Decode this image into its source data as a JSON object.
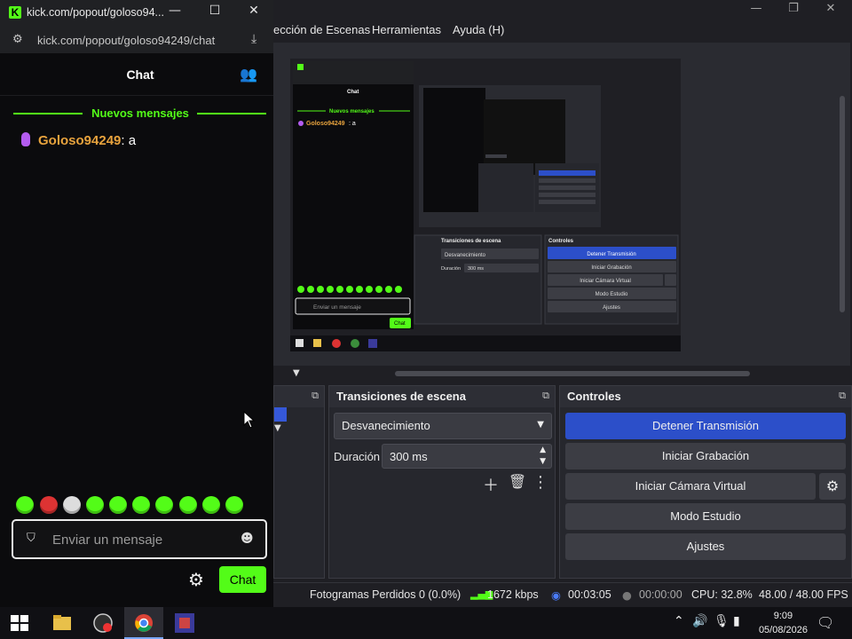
{
  "obs": {
    "menu": [
      "ección de Escenas",
      "Herramientas",
      "Ayuda (H)"
    ],
    "transitions": {
      "title": "Transiciones de escena",
      "transition_value": "Desvanecimiento",
      "duration_label": "Duración",
      "duration_value": "300 ms"
    },
    "controls": {
      "title": "Controles",
      "buttons": [
        "Detener Transmisión",
        "Iniciar Grabación",
        "Iniciar Cámara Virtual",
        "Modo Estudio",
        "Ajustes"
      ]
    },
    "status": {
      "dropped_frames": "Fotogramas Perdidos 0 (0.0%)",
      "bitrate": "1672 kbps",
      "live_time": "00:03:05",
      "rec_time": "00:00:00",
      "cpu": "CPU: 32.8%",
      "fps": "48.00 / 48.00 FPS"
    },
    "colors": {
      "primary_button": "#2c4fc9",
      "kick_green": "#53fc18",
      "username": "#e8a33d"
    }
  },
  "popout": {
    "title": "kick.com/popout/goloso94...",
    "url": "kick.com/popout/goloso94249/chat",
    "chat_title": "Chat",
    "new_messages": "Nuevos mensajes",
    "message": {
      "user": "Goloso94249",
      "text": ": a"
    },
    "input_placeholder": "Enviar un mensaje",
    "send_label": "Chat"
  },
  "preview": {
    "chat_title": "Chat",
    "new_messages": "Nuevos mensajes",
    "message_user": "Goloso94249",
    "message_text": ": a",
    "input_placeholder": "Enviar un mensaje",
    "send_label": "Chat",
    "transitions_title": "Transiciones de escena",
    "transition_value": "Desvanecimiento",
    "duration_label": "Duración",
    "duration_value": "300 ms",
    "controls_title": "Controles",
    "buttons": [
      "Detener Transmisión",
      "Iniciar Grabación",
      "Iniciar Cámara Virtual",
      "Modo Estudio",
      "Ajustes"
    ]
  },
  "taskbar": {
    "time": "9:09",
    "date": "05/08/2026"
  }
}
